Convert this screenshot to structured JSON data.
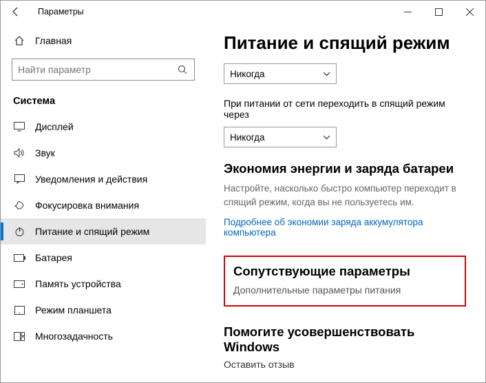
{
  "titlebar": {
    "title": "Параметры"
  },
  "sidebar": {
    "home": "Главная",
    "search_placeholder": "Найти параметр",
    "category": "Система",
    "items": [
      {
        "label": "Дисплей"
      },
      {
        "label": "Звук"
      },
      {
        "label": "Уведомления и действия"
      },
      {
        "label": "Фокусировка внимания"
      },
      {
        "label": "Питание и спящий режим"
      },
      {
        "label": "Батарея"
      },
      {
        "label": "Память устройства"
      },
      {
        "label": "Режим планшета"
      },
      {
        "label": "Многозадачность"
      }
    ]
  },
  "main": {
    "heading": "Питание и спящий режим",
    "dd1_value": "Никогда",
    "label2": "При питании от сети переходить в спящий режим через",
    "dd2_value": "Никогда",
    "battery_h": "Экономия энергии и заряда батареи",
    "battery_p": "Настройте, насколько быстро компьютер переходит в спящий режим, когда вы не пользуетесь им.",
    "battery_link": "Подробнее об экономии заряда аккумулятора компьютера",
    "related_h": "Сопутствующие параметры",
    "related_sub": "Дополнительные параметры питания",
    "feedback_h": "Помогите усовершенствовать Windows",
    "feedback_sub": "Оставить отзыв"
  }
}
